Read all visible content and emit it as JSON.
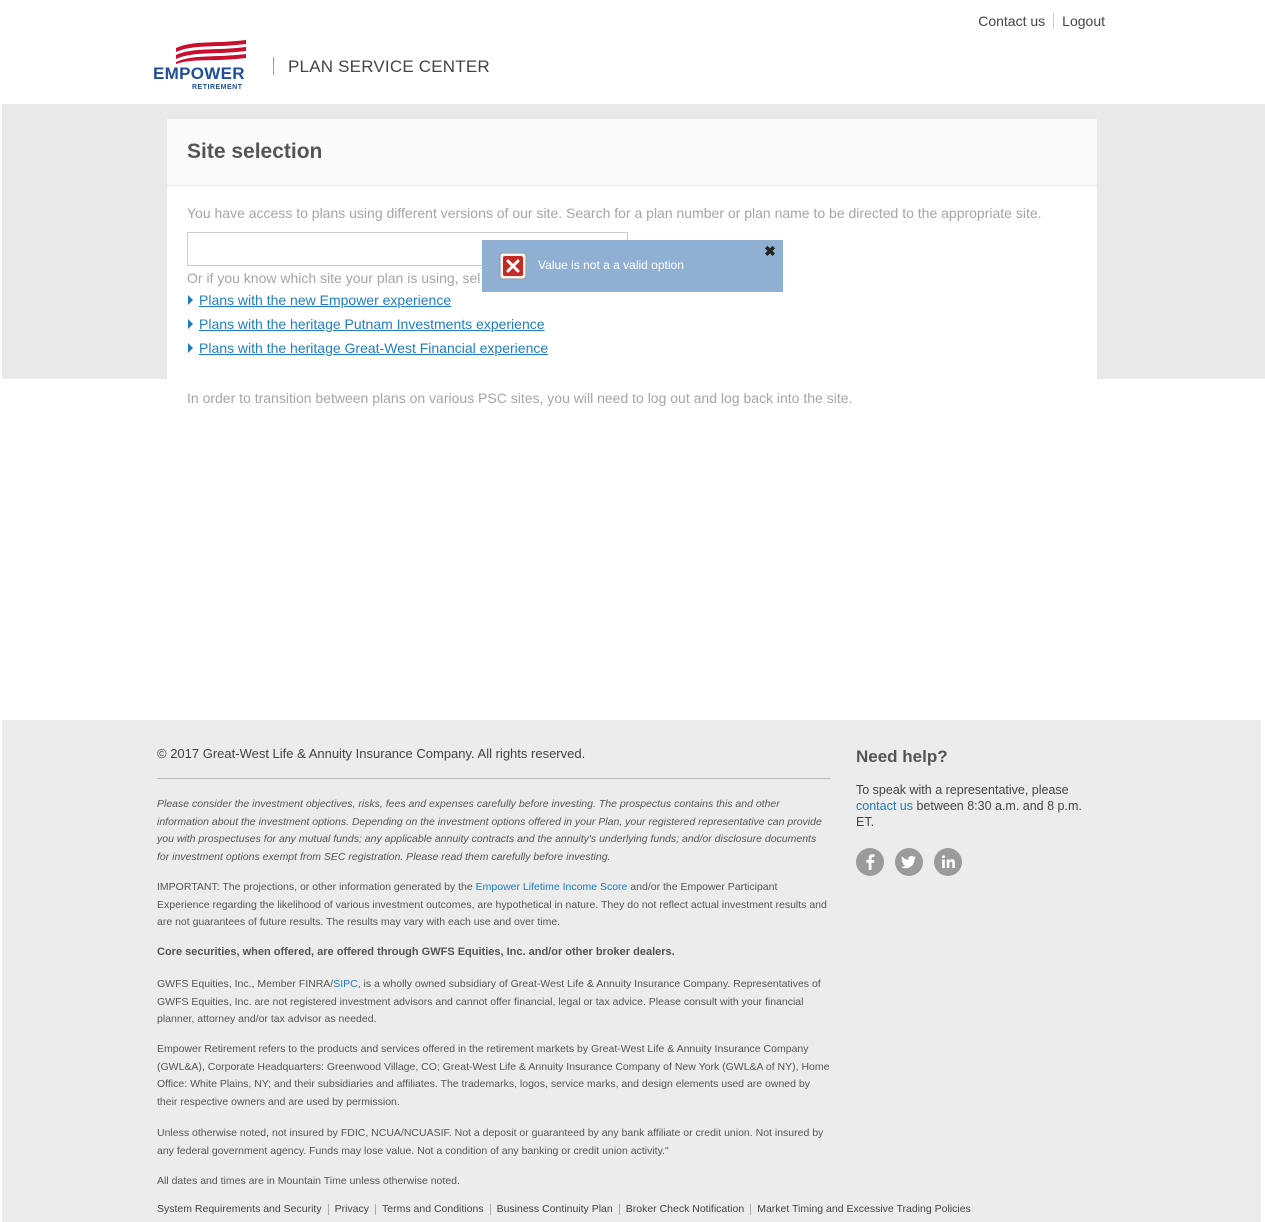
{
  "header": {
    "contact_us": "Contact us",
    "logout": "Logout",
    "logo_word": "EMPOWER",
    "logo_sub": "RETIREMENT",
    "site_title": "PLAN SERVICE CENTER"
  },
  "site_selection": {
    "title": "Site selection",
    "intro": "You have access to plans using different versions of our site. Search for a plan number or plan name to be directed to the appropriate site.",
    "search_value": "",
    "or_text": "Or if you know which site your plan is using, sel",
    "links": [
      "Plans with the new Empower experience",
      "Plans with the heritage Putnam Investments experience",
      "Plans with the heritage Great-West Financial experience"
    ],
    "transition_note": "In order to transition between plans on various PSC sites, you will need to log out and log back into the site."
  },
  "error_popup": {
    "message": "Value is not a a valid option",
    "close_glyph": "✖"
  },
  "footer": {
    "copyright": "© 2017 Great-West Life & Annuity Insurance Company. All rights reserved.",
    "prospectus": "Please consider the investment objectives, risks, fees and expenses carefully before investing. The prospectus contains this and other information about the investment options. Depending on the investment options offered in your Plan, your registered representative can provide you with prospectuses for any mutual funds; any applicable annuity contracts and the annuity's underlying funds; and/or disclosure documents for investment options exempt from SEC registration. Please read them carefully before investing.",
    "important_pre": "IMPORTANT: The projections, or other information generated by the ",
    "important_link": "Empower Lifetime Income Score",
    "important_post": " and/or the Empower Participant Experience regarding the likelihood of various investment outcomes, are hypothetical in nature. They do not reflect actual investment results and are not guarantees of future results. The results may vary with each use and over time.",
    "core": "Core securities, when offered, are offered through GWFS Equities, Inc. and/or other broker dealers.",
    "gwfs_pre": "GWFS Equities, Inc., Member FINRA/",
    "gwfs_link": "SIPC",
    "gwfs_post": ", is a wholly owned subsidiary of Great-West Life & Annuity Insurance Company. Representatives of GWFS Equities, Inc. are not registered investment advisors and cannot offer financial, legal or tax advice. Please consult with your financial planner, attorney and/or tax advisor as needed.",
    "empower_refers": "Empower Retirement refers to the products and services offered in the retirement markets by Great-West Life & Annuity Insurance Company (GWL&A), Corporate Headquarters: Greenwood Village, CO; Great-West Life & Annuity Insurance Company of New York (GWL&A of NY), Home Office: White Plains, NY; and their subsidiaries and affiliates. The trademarks, logos, service marks, and design elements used are owned by their respective owners and are used by permission.",
    "fdic": "Unless otherwise noted, not insured by FDIC, NCUA/NCUASIF. Not a deposit or guaranteed by any bank affiliate or credit union. Not insured by any federal government agency. Funds may lose value. Not a condition of any banking or credit union activity.\"",
    "dates": "All dates and times are in Mountain Time unless otherwise noted.",
    "need_help_title": "Need help?",
    "help_pre": "To speak with a representative, please",
    "help_link": "contact us",
    "help_post": " between 8:30 a.m. and 8 p.m. ET.",
    "social": [
      "facebook-icon",
      "twitter-icon",
      "linkedin-icon"
    ],
    "bottom_links": [
      "System Requirements and Security",
      "Privacy",
      "Terms and Conditions",
      "Business Continuity Plan",
      "Broker Check Notification",
      "Market Timing and Excessive Trading Policies"
    ]
  },
  "colors": {
    "link": "#1e7fc0",
    "brand_blue": "#1f4e9a",
    "brand_red": "#c8102e",
    "error_bg": "#8fb0d3",
    "band": "#e9e9e9"
  }
}
